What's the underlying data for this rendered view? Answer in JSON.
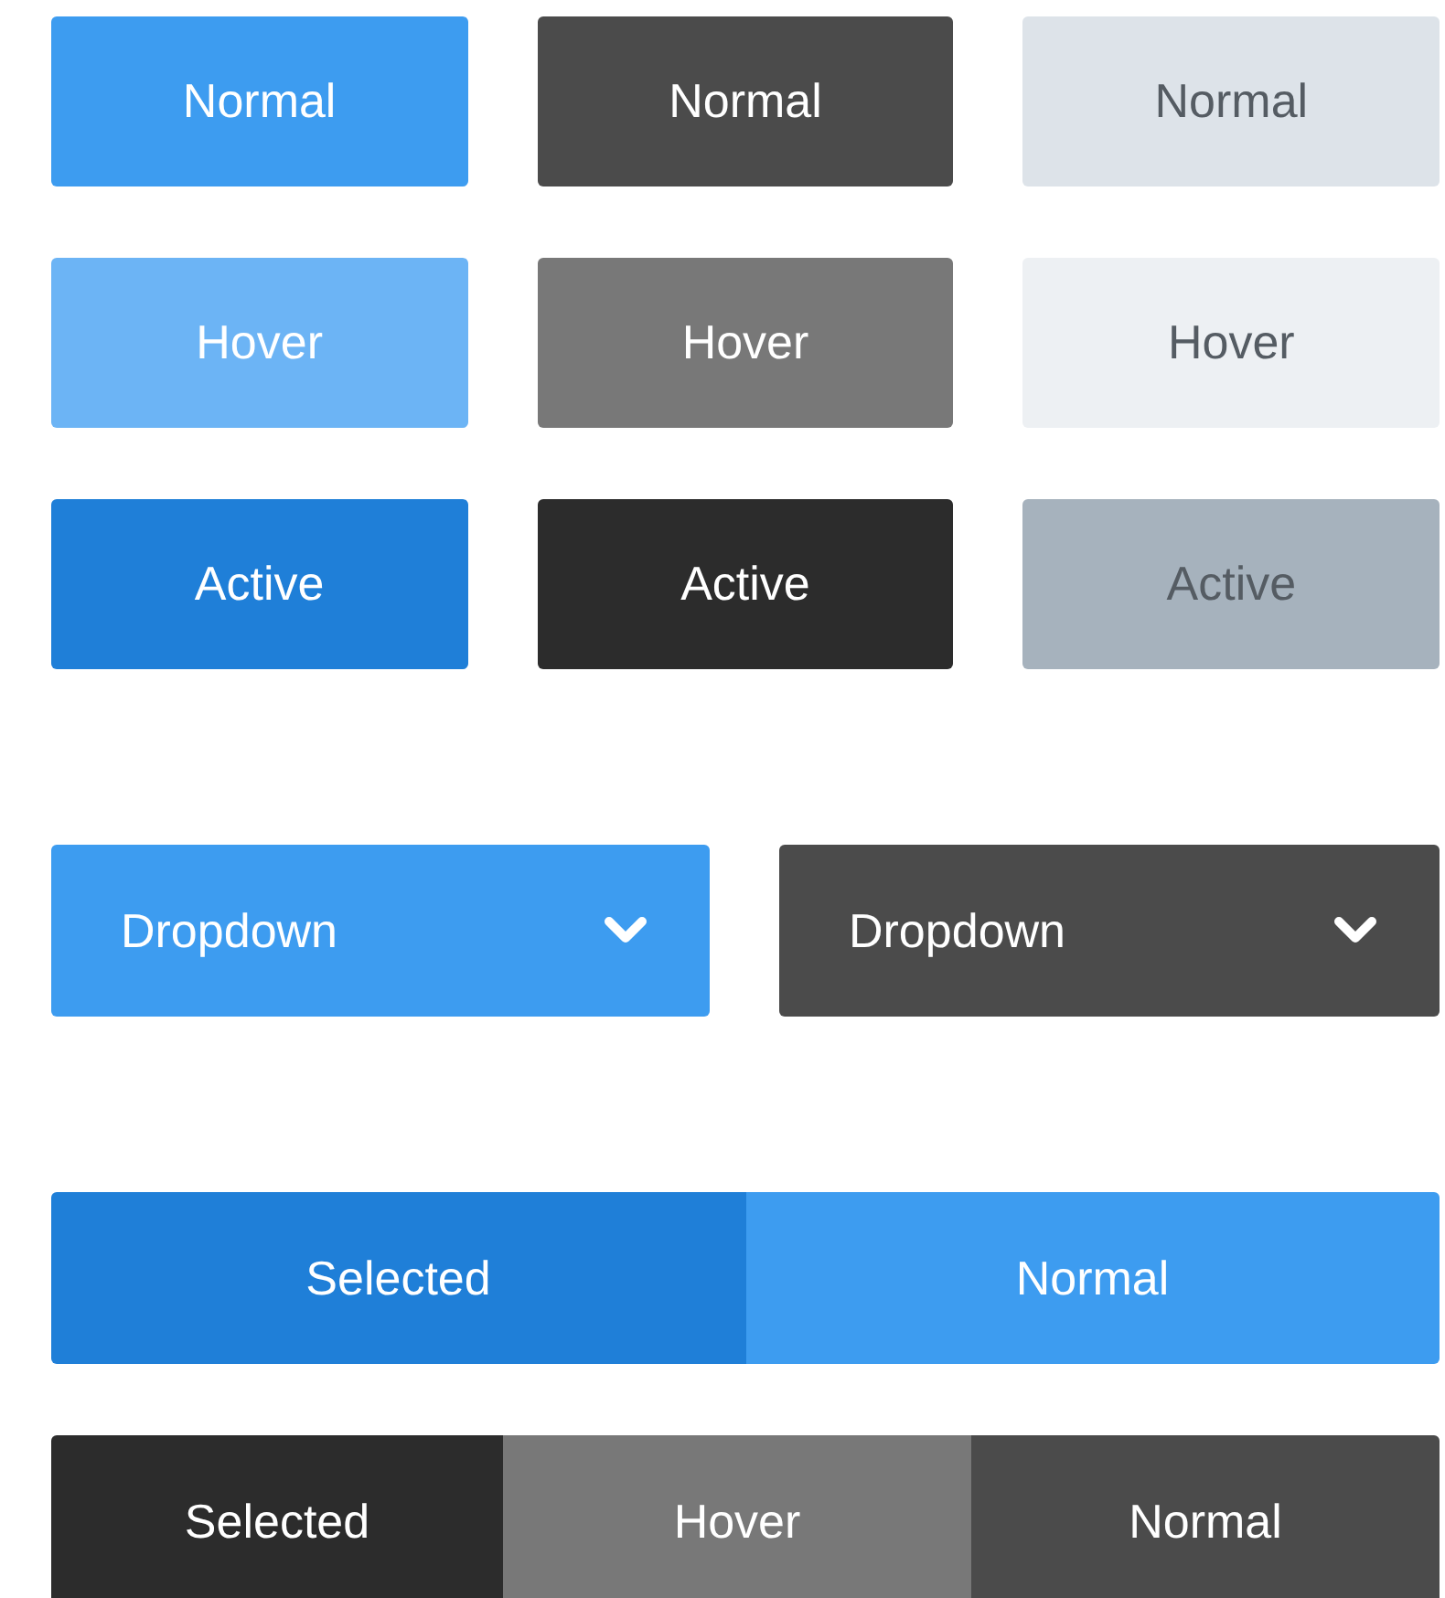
{
  "button_grid": [
    {
      "buttons": [
        {
          "kind": "blue",
          "hovered": false,
          "pressed": false,
          "label": "Normal"
        },
        {
          "kind": "dark",
          "hovered": false,
          "pressed": false,
          "label": "Normal"
        },
        {
          "kind": "light",
          "hovered": false,
          "pressed": false,
          "label": "Normal"
        }
      ]
    },
    {
      "buttons": [
        {
          "kind": "blue",
          "hovered": true,
          "pressed": false,
          "label": "Hover"
        },
        {
          "kind": "dark",
          "hovered": true,
          "pressed": false,
          "label": "Hover"
        },
        {
          "kind": "light",
          "hovered": true,
          "pressed": false,
          "label": "Hover"
        }
      ]
    },
    {
      "buttons": [
        {
          "kind": "blue",
          "hovered": false,
          "pressed": true,
          "label": "Active"
        },
        {
          "kind": "dark",
          "hovered": false,
          "pressed": true,
          "label": "Active"
        },
        {
          "kind": "light",
          "hovered": false,
          "pressed": true,
          "label": "Active"
        }
      ]
    }
  ],
  "dropdowns": [
    {
      "kind": "blue",
      "label": "Dropdown"
    },
    {
      "kind": "dark",
      "label": "Dropdown"
    }
  ],
  "segmented_controls": [
    {
      "kind": "blue",
      "segments": [
        {
          "label": "Selected",
          "selected": true,
          "hovered": false
        },
        {
          "label": "Normal",
          "selected": false,
          "hovered": false
        }
      ]
    },
    {
      "kind": "dark",
      "segments": [
        {
          "label": "Selected",
          "selected": true,
          "hovered": false
        },
        {
          "label": "Hover",
          "selected": false,
          "hovered": true
        },
        {
          "label": "Normal",
          "selected": false,
          "hovered": false
        }
      ]
    }
  ]
}
